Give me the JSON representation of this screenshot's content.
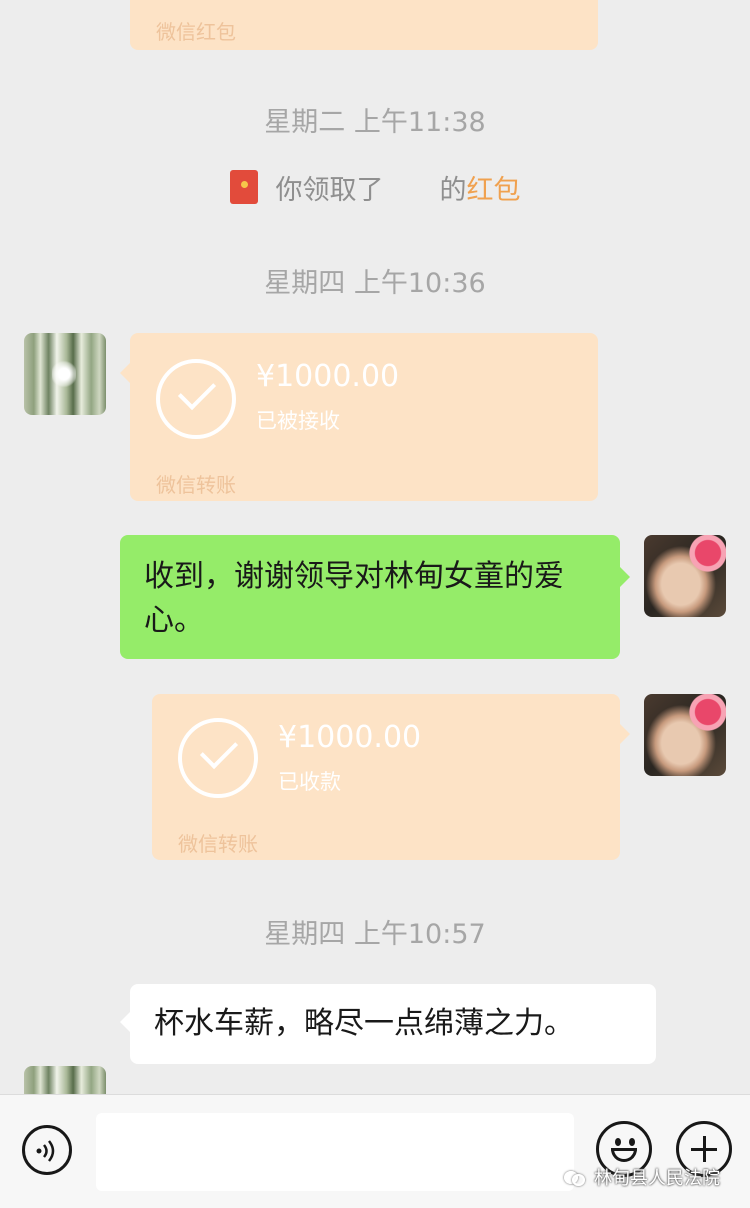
{
  "top_redpacket": {
    "footer": "微信红包"
  },
  "timestamps": [
    "星期二 上午11:38",
    "星期四 上午10:36",
    "星期四 上午10:57"
  ],
  "system_notice": {
    "prefix": "你领取了",
    "middle": "的",
    "link": "红包"
  },
  "transfer_received": {
    "amount": "¥1000.00",
    "status": "已被接收",
    "footer": "微信转账"
  },
  "outgoing_message": {
    "text": "收到，谢谢领导对林甸女童的爱心。"
  },
  "transfer_collected": {
    "amount": "¥1000.00",
    "status": "已收款",
    "footer": "微信转账"
  },
  "incoming_message": {
    "text": "杯水车薪，略尽一点绵薄之力。"
  },
  "input_bar": {
    "value": ""
  },
  "watermark": {
    "text": "林甸县人民法院"
  },
  "colors": {
    "background": "#ededed",
    "outgoing_bubble": "#95ec69",
    "transfer_bubble": "#fde3c6",
    "link": "#f0a14f",
    "red_packet_icon": "#e24b3b"
  }
}
